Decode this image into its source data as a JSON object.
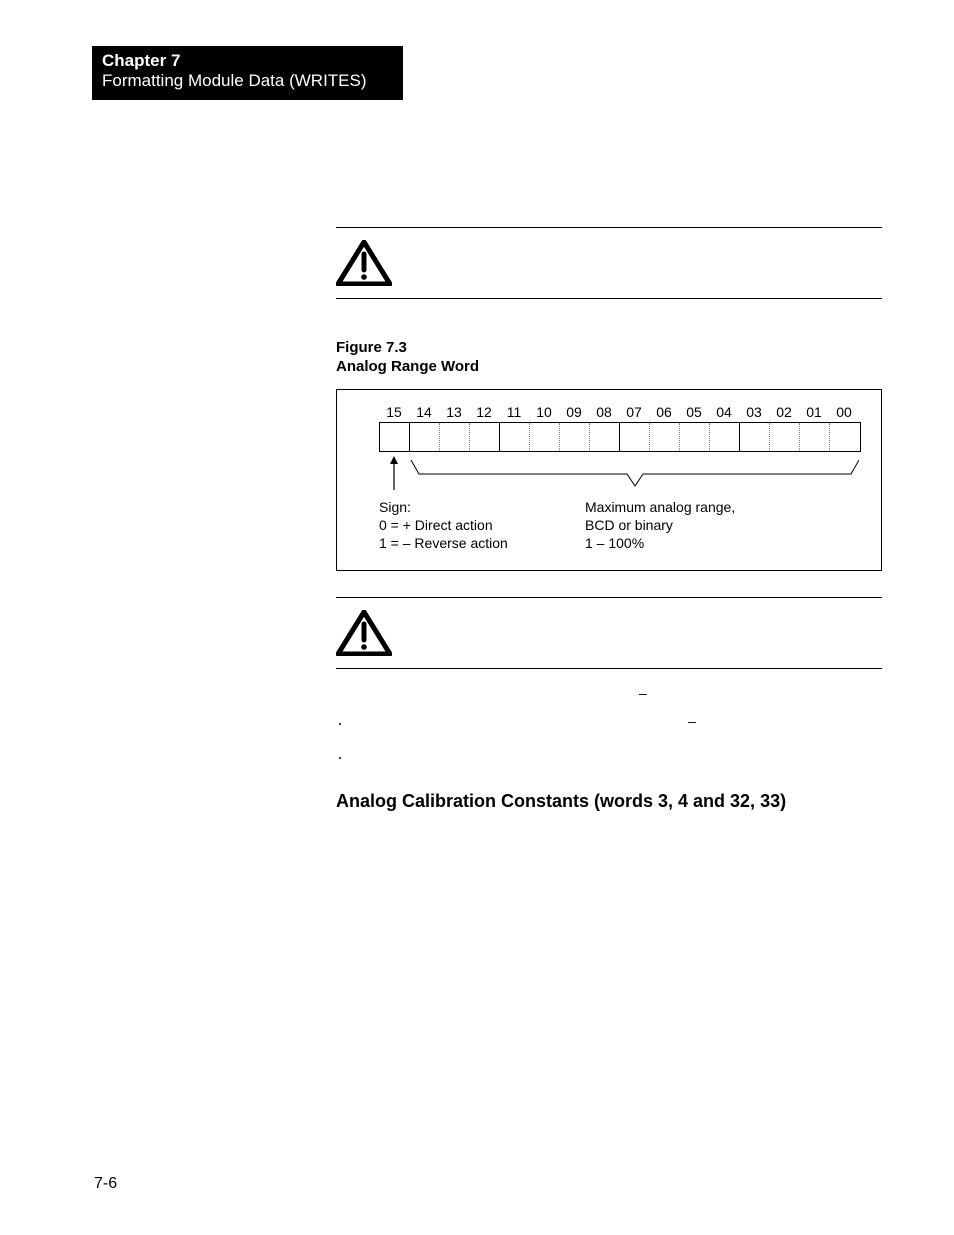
{
  "header": {
    "chapter_line": "Chapter 7",
    "subtitle": "Formatting Module Data (WRITES)"
  },
  "figure": {
    "number_line": "Figure 7.3",
    "title_line": "Analog Range Word"
  },
  "diagram": {
    "bit_labels": [
      "15",
      "14",
      "13",
      "12",
      "11",
      "10",
      "09",
      "08",
      "07",
      "06",
      "05",
      "04",
      "03",
      "02",
      "01",
      "00"
    ],
    "sign_block": {
      "l1": "Sign:",
      "l2": "0 = + Direct action",
      "l3": "1 = – Reverse action"
    },
    "range_block": {
      "l1": "Maximum analog range,",
      "l2": "BCD or binary",
      "l3": "1 – 100%"
    }
  },
  "list": {
    "lead_line": " ",
    "bullet1": " ",
    "bullet2": " ",
    "dash1": "–",
    "dash2": "–"
  },
  "subsection_heading": "Analog Calibration Constants (words 3, 4 and 32, 33)",
  "page_number": "7-6"
}
